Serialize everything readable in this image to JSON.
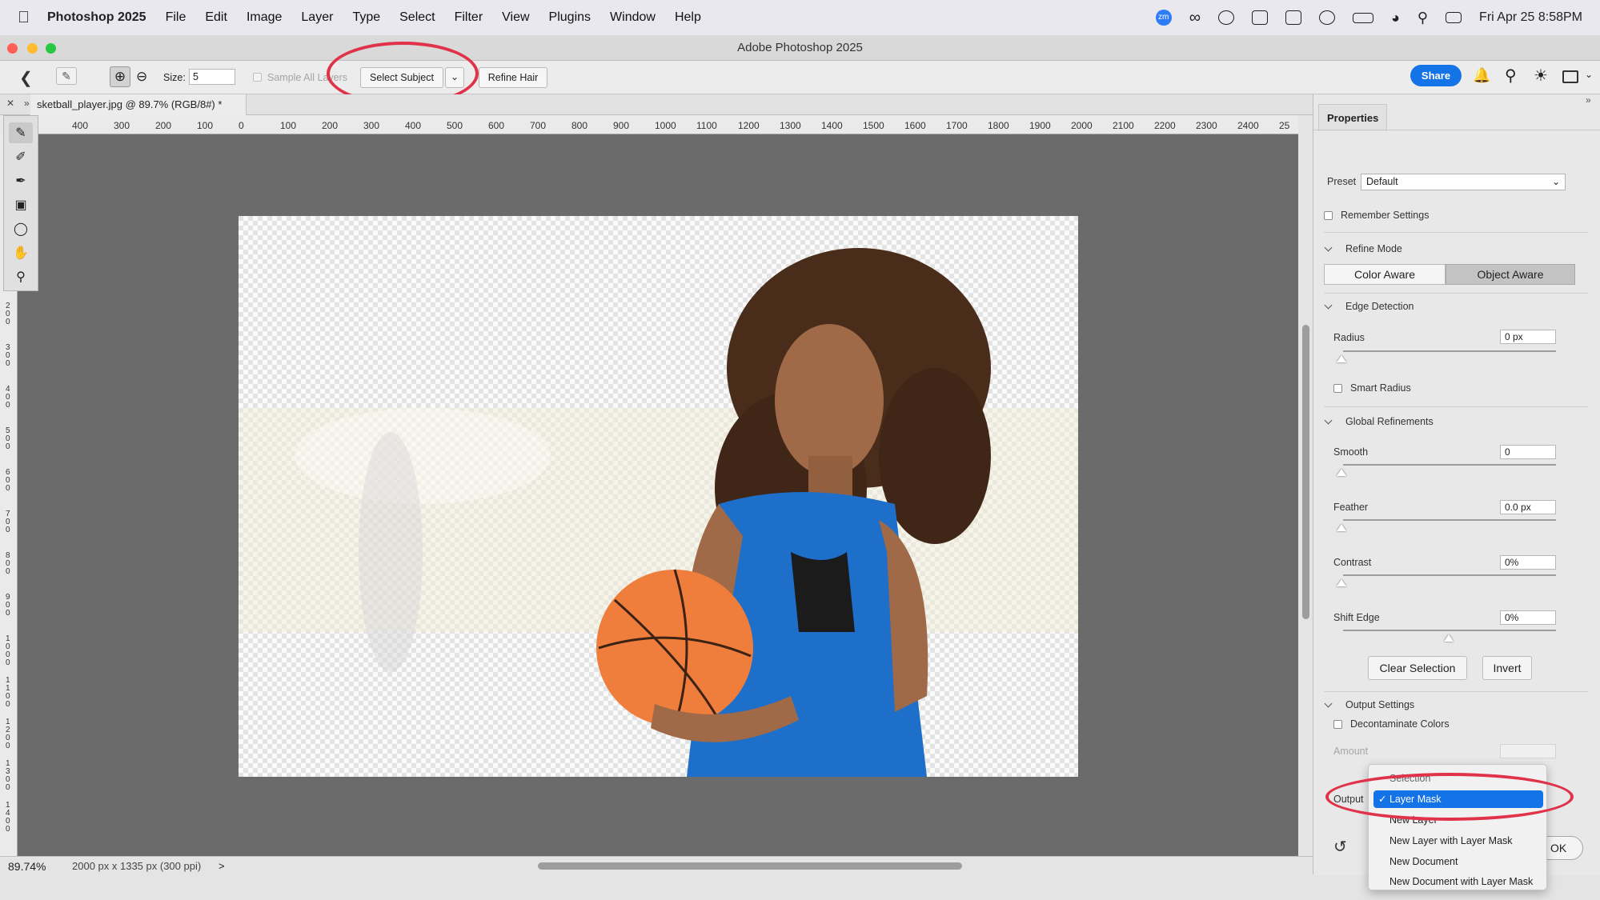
{
  "menubar": {
    "app_name": "Photoshop 2025",
    "items": [
      "File",
      "Edit",
      "Image",
      "Layer",
      "Type",
      "Select",
      "Filter",
      "View",
      "Plugins",
      "Window",
      "Help"
    ],
    "datetime": "Fri Apr 25  8:58PM",
    "zoom_badge": "zm"
  },
  "window": {
    "title": "Adobe Photoshop 2025"
  },
  "options": {
    "size_label": "Size:",
    "size_value": "5",
    "sample_all_layers": "Sample All Layers",
    "select_subject": "Select Subject",
    "refine_hair": "Refine Hair",
    "share": "Share"
  },
  "document": {
    "tab_title": "sketball_player.jpg @ 89.7% (RGB/8#) *",
    "ruler_h": [
      "400",
      "300",
      "200",
      "100",
      "0",
      "100",
      "200",
      "300",
      "400",
      "500",
      "600",
      "700",
      "800",
      "900",
      "1000",
      "1100",
      "1200",
      "1300",
      "1400",
      "1500",
      "1600",
      "1700",
      "1800",
      "1900",
      "2000",
      "2100",
      "2200",
      "2300",
      "2400",
      "25"
    ],
    "ruler_v": [
      "200",
      "300",
      "400",
      "500",
      "600",
      "700",
      "800",
      "900",
      "1000",
      "1100",
      "1200",
      "1300",
      "1400"
    ]
  },
  "status": {
    "zoom": "89.74%",
    "doc_info": "2000 px x 1335 px (300 ppi)",
    "arrow": ">"
  },
  "properties": {
    "tab": "Properties",
    "preset_label": "Preset",
    "preset_value": "Default",
    "remember_settings": "Remember Settings",
    "refine_mode": {
      "title": "Refine Mode",
      "color_aware": "Color Aware",
      "object_aware": "Object Aware"
    },
    "edge_detection": {
      "title": "Edge Detection",
      "radius_label": "Radius",
      "radius_value": "0 px",
      "smart_radius": "Smart Radius"
    },
    "global": {
      "title": "Global Refinements",
      "smooth_label": "Smooth",
      "smooth_value": "0",
      "feather_label": "Feather",
      "feather_value": "0.0 px",
      "contrast_label": "Contrast",
      "contrast_value": "0%",
      "shift_label": "Shift Edge",
      "shift_value": "0%"
    },
    "clear_selection": "Clear Selection",
    "invert": "Invert",
    "output": {
      "title": "Output Settings",
      "decontaminate": "Decontaminate Colors",
      "amount_label": "Amount",
      "output_label": "Output",
      "ok": "OK",
      "options": [
        "Selection",
        "Layer Mask",
        "New Layer",
        "New Layer with Layer Mask",
        "New Document",
        "New Document with Layer Mask"
      ],
      "selected": "Layer Mask"
    }
  },
  "colors": {
    "accent": "#1473e6",
    "highlight_ring": "#e0334a",
    "canvas": "#6b6b6b"
  }
}
